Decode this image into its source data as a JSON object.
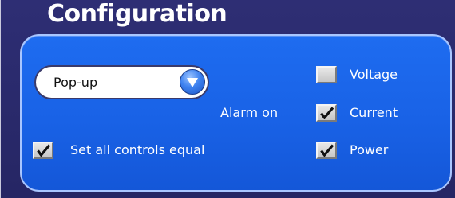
{
  "window": {
    "title": "Configuration"
  },
  "popup": {
    "value": "Pop-up"
  },
  "alarm": {
    "label": "Alarm on",
    "options": [
      {
        "label": "Voltage",
        "checked": false
      },
      {
        "label": "Current",
        "checked": true
      },
      {
        "label": "Power",
        "checked": true
      }
    ]
  },
  "set_all": {
    "label": "Set all controls equal",
    "checked": true
  },
  "colors": {
    "window_bg": "#2a2a6e",
    "panel_bg": "#1962e6",
    "panel_border": "#a9c6ff"
  }
}
